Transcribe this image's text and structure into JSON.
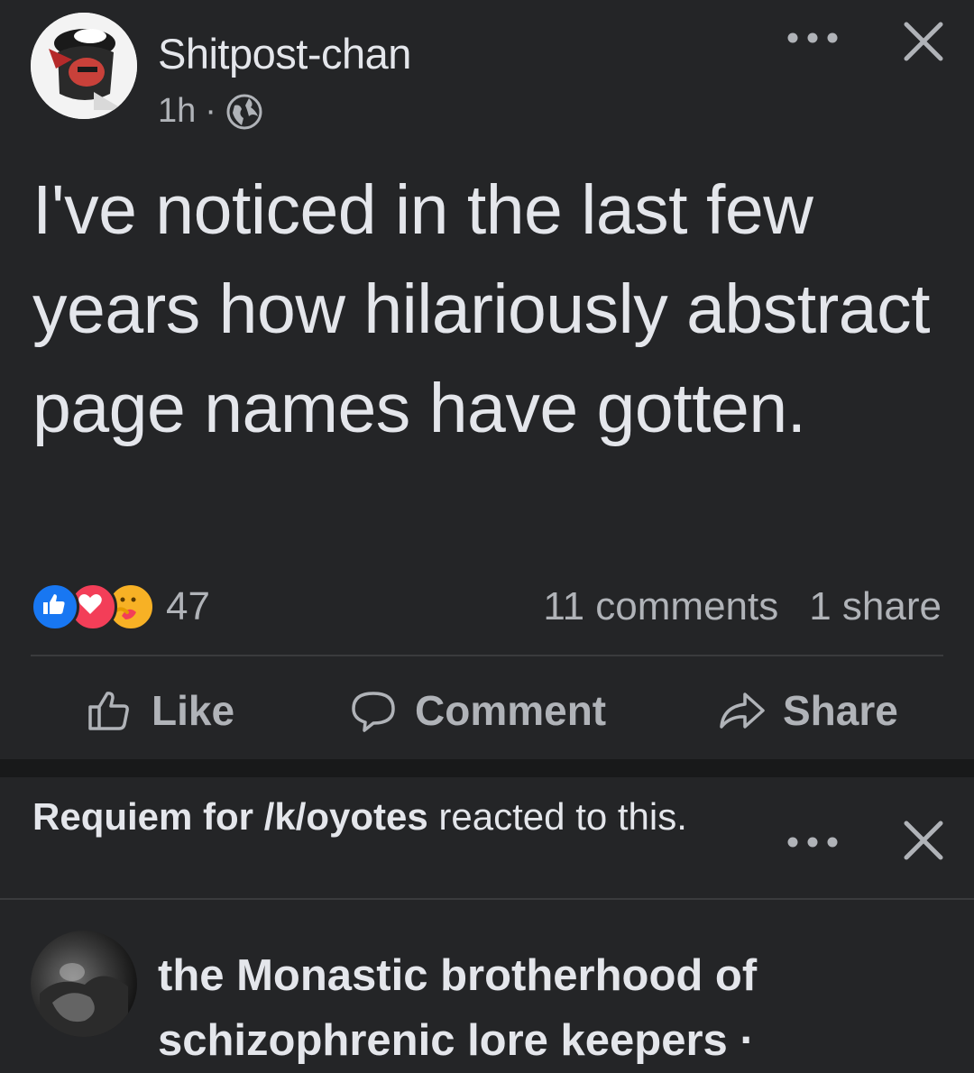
{
  "post": {
    "author": "Shitpost-chan",
    "time": "1h",
    "separator": "·",
    "text": "I've noticed in the last few years how hilariously abstract page names have gotten.",
    "reactions": {
      "icons": [
        "like-icon",
        "love-icon",
        "care-icon"
      ],
      "count": "47",
      "comments": "11 comments",
      "shares": "1 share"
    },
    "actions": {
      "like": "Like",
      "comment": "Comment",
      "share": "Share"
    }
  },
  "notice": {
    "name": "Requiem for /k/oyotes",
    "text": " reacted to this."
  },
  "next_post": {
    "author": "the Monastic brotherhood of schizophrenic lore keepers ·"
  },
  "colors": {
    "background": "#242527",
    "text": "#e4e6eb",
    "muted": "#b0b3b8",
    "like_blue": "#1877f2",
    "love_red": "#f33e58",
    "care_yellow": "#f7b125"
  }
}
